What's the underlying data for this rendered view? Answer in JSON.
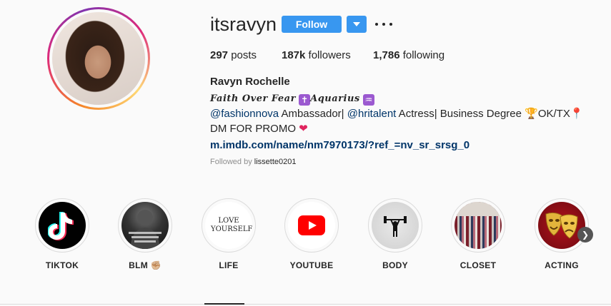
{
  "profile": {
    "username": "itsravyn",
    "follow_label": "Follow",
    "stats": {
      "posts_count": "297",
      "posts_label": "posts",
      "followers_count": "187k",
      "followers_label": "followers",
      "following_count": "1,786",
      "following_label": "following"
    },
    "full_name": "Ravyn Rochelle",
    "bio": {
      "line1_text": "Faith Over Fear",
      "line1_text2": "Aquarius",
      "mention1": "@fashionnova",
      "after_mention1": " Ambassador| ",
      "mention2": "@hritalent",
      "after_mention2": " Actress| Business Degree ",
      "after_trophy": "OK/TX",
      "after_pin": "DM FOR PROMO ",
      "link": "m.imdb.com/name/nm7970173/?ref_=nv_sr_srsg_0"
    },
    "followed_by_prefix": "Followed by",
    "followed_by_user": "lissette0201"
  },
  "highlights": [
    {
      "label": "TIKTOK"
    },
    {
      "label": "BLM ✊🏼"
    },
    {
      "label": "LIFE",
      "image_text": "LOVE YOURSELF"
    },
    {
      "label": "YOUTUBE"
    },
    {
      "label": "BODY"
    },
    {
      "label": "CLOSET"
    },
    {
      "label": "ACTING"
    }
  ],
  "colors": {
    "follow_blue": "#3897f0",
    "link_blue": "#003569",
    "tiktok_cyan": "#25f4ee",
    "tiktok_red": "#fe2c55",
    "youtube_red": "#ff0000"
  },
  "icons": [
    "chevron-down-icon",
    "more-options-icon",
    "chevron-right-icon",
    "tiktok-icon",
    "youtube-icon",
    "weightlifter-icon",
    "drama-masks-icon",
    "trophy-icon",
    "pin-icon",
    "heart-icon",
    "cross-icon",
    "aquarius-icon"
  ]
}
